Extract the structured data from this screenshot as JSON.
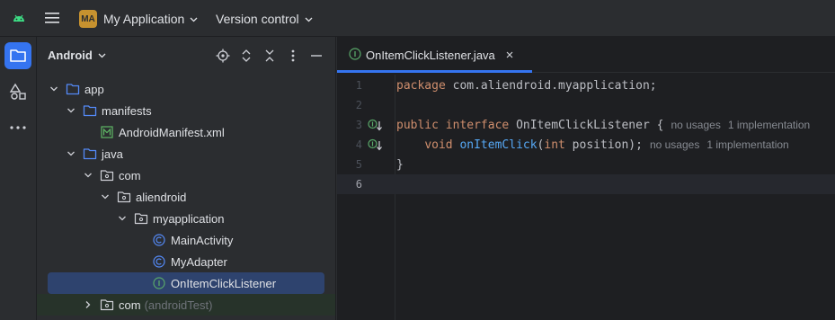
{
  "titlebar": {
    "project_badge": "MA",
    "project_name": "My Application",
    "vcs_label": "Version control"
  },
  "project_panel": {
    "title": "Android",
    "tree": [
      {
        "label": "app",
        "icon": "folder-icon",
        "expanded": true
      },
      {
        "label": "manifests",
        "icon": "folder-icon",
        "expanded": true
      },
      {
        "label": "AndroidManifest.xml",
        "icon": "manifest-file-icon"
      },
      {
        "label": "java",
        "icon": "folder-icon",
        "expanded": true
      },
      {
        "label": "com",
        "icon": "package-icon",
        "expanded": true
      },
      {
        "label": "aliendroid",
        "icon": "package-icon",
        "expanded": true
      },
      {
        "label": "myapplication",
        "icon": "package-icon",
        "expanded": true
      },
      {
        "label": "MainActivity",
        "icon": "class-icon"
      },
      {
        "label": "MyAdapter",
        "icon": "class-icon"
      },
      {
        "label": "OnItemClickListener",
        "icon": "interface-icon",
        "selected": true
      },
      {
        "label": "com",
        "suffix": "(androidTest)",
        "icon": "package-icon",
        "expanded": false
      }
    ]
  },
  "editor": {
    "tab_label": "OnItemClickListener.java",
    "lines": [
      {
        "num": "1",
        "kw": "package",
        "rest": " com.aliendroid.myapplication;"
      },
      {
        "num": "2"
      },
      {
        "num": "3",
        "kw1": "public",
        "kw2": "interface",
        "rest": " OnItemClickListener {",
        "hint1": "no usages",
        "hint2": "1 implementation"
      },
      {
        "num": "4",
        "kw": "void",
        "fn": "onItemClick",
        "kw2": "int",
        "rest": " position);",
        "hint1": "no usages",
        "hint2": "1 implementation"
      },
      {
        "num": "5",
        "rest": "}"
      },
      {
        "num": "6"
      }
    ]
  },
  "colors": {
    "accent": "#3574f0",
    "keyword": "#cf8e6d",
    "function": "#56a8f5",
    "badge": "#c7922f",
    "interface_icon": "#59a869",
    "class_icon": "#3574f0"
  }
}
